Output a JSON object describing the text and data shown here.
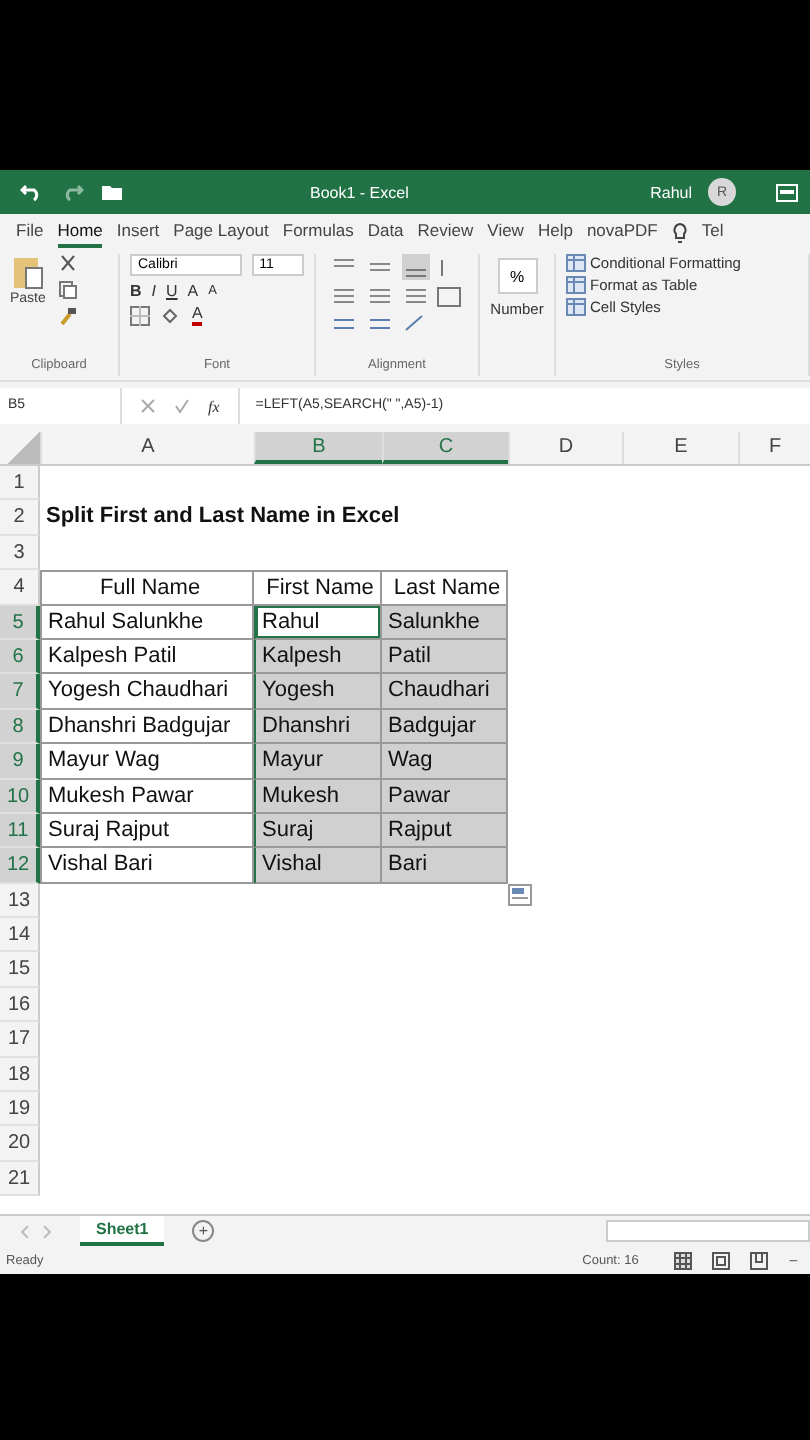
{
  "title_bar": {
    "title": "Book1  -  Excel",
    "user": "Rahul",
    "avatar_initial": "R"
  },
  "menu_tabs": [
    {
      "label": "File",
      "selected": false
    },
    {
      "label": "Home",
      "selected": true
    },
    {
      "label": "Insert",
      "selected": false
    },
    {
      "label": "Page Layout",
      "selected": false
    },
    {
      "label": "Formulas",
      "selected": false
    },
    {
      "label": "Data",
      "selected": false
    },
    {
      "label": "Review",
      "selected": false
    },
    {
      "label": "View",
      "selected": false
    },
    {
      "label": "Help",
      "selected": false
    },
    {
      "label": "novaPDF",
      "selected": false
    }
  ],
  "tell_me": "Tel",
  "ribbon": {
    "clipboard": {
      "paste": "Paste",
      "label": "Clipboard"
    },
    "font": {
      "name": "Calibri",
      "size": "11",
      "bold": "B",
      "italic": "I",
      "underline": "U",
      "grow": "A",
      "shrink": "A",
      "font_color_glyph": "A",
      "label": "Font"
    },
    "alignment": {
      "label": "Alignment"
    },
    "number": {
      "symbol": "%",
      "label": "Number"
    },
    "styles": {
      "items": [
        "Conditional Formatting",
        "Format as Table",
        "Cell Styles"
      ],
      "label": "Styles"
    }
  },
  "formula_bar": {
    "name_box": "B5",
    "fx": "fx",
    "formula": "=LEFT(A5,SEARCH(\" \",A5)-1)"
  },
  "columns": [
    {
      "label": "A",
      "selected": false
    },
    {
      "label": "B",
      "selected": true
    },
    {
      "label": "C",
      "selected": true
    },
    {
      "label": "D",
      "selected": false
    },
    {
      "label": "E",
      "selected": false
    },
    {
      "label": "F",
      "selected": false
    }
  ],
  "rows": [
    {
      "number": "1",
      "selected": false,
      "kind": "empty"
    },
    {
      "number": "2",
      "selected": false,
      "kind": "title",
      "cells": [
        {
          "text": "Split First and Last Name in Excel"
        }
      ]
    },
    {
      "number": "3",
      "selected": false,
      "kind": "empty"
    },
    {
      "number": "4",
      "selected": false,
      "kind": "header",
      "cells": [
        {
          "text": "Full Name",
          "active": false
        },
        {
          "text": "First Name",
          "active": false
        },
        {
          "text": "Last Name",
          "active": false
        }
      ]
    },
    {
      "number": "5",
      "selected": true,
      "kind": "data",
      "cells": [
        {
          "text": "Rahul Salunkhe",
          "active": false
        },
        {
          "text": "Rahul",
          "active": true
        },
        {
          "text": "Salunkhe",
          "active": false
        }
      ]
    },
    {
      "number": "6",
      "selected": true,
      "kind": "data",
      "cells": [
        {
          "text": "Kalpesh Patil",
          "active": false
        },
        {
          "text": "Kalpesh",
          "active": false
        },
        {
          "text": "Patil",
          "active": false
        }
      ]
    },
    {
      "number": "7",
      "selected": true,
      "kind": "data",
      "cells": [
        {
          "text": "Yogesh Chaudhari",
          "active": false
        },
        {
          "text": "Yogesh",
          "active": false
        },
        {
          "text": "Chaudhari",
          "active": false
        }
      ]
    },
    {
      "number": "8",
      "selected": true,
      "kind": "data",
      "cells": [
        {
          "text": "Dhanshri Badgujar",
          "active": false
        },
        {
          "text": "Dhanshri",
          "active": false
        },
        {
          "text": "Badgujar",
          "active": false
        }
      ]
    },
    {
      "number": "9",
      "selected": true,
      "kind": "data",
      "cells": [
        {
          "text": "Mayur Wag",
          "active": false
        },
        {
          "text": "Mayur",
          "active": false
        },
        {
          "text": "Wag",
          "active": false
        }
      ]
    },
    {
      "number": "10",
      "selected": true,
      "kind": "data",
      "cells": [
        {
          "text": "Mukesh Pawar",
          "active": false
        },
        {
          "text": "Mukesh",
          "active": false
        },
        {
          "text": "Pawar",
          "active": false
        }
      ]
    },
    {
      "number": "11",
      "selected": true,
      "kind": "data",
      "cells": [
        {
          "text": "Suraj Rajput",
          "active": false
        },
        {
          "text": "Suraj",
          "active": false
        },
        {
          "text": "Rajput",
          "active": false
        }
      ]
    },
    {
      "number": "12",
      "selected": true,
      "kind": "data",
      "cells": [
        {
          "text": "Vishal Bari",
          "active": false
        },
        {
          "text": "Vishal",
          "active": false
        },
        {
          "text": "Bari",
          "active": false
        }
      ]
    },
    {
      "number": "13",
      "selected": false,
      "kind": "empty"
    },
    {
      "number": "14",
      "selected": false,
      "kind": "empty"
    },
    {
      "number": "15",
      "selected": false,
      "kind": "empty"
    },
    {
      "number": "16",
      "selected": false,
      "kind": "empty"
    },
    {
      "number": "17",
      "selected": false,
      "kind": "empty"
    },
    {
      "number": "18",
      "selected": false,
      "kind": "empty"
    },
    {
      "number": "19",
      "selected": false,
      "kind": "empty"
    },
    {
      "number": "20",
      "selected": false,
      "kind": "empty"
    },
    {
      "number": "21",
      "selected": false,
      "kind": "empty"
    }
  ],
  "sheet_tabs": [
    {
      "label": "Sheet1",
      "selected": true
    }
  ],
  "add_sheet": "+",
  "status_bar": {
    "mode": "Ready",
    "count": "Count: 16",
    "zoom_out": "−"
  }
}
